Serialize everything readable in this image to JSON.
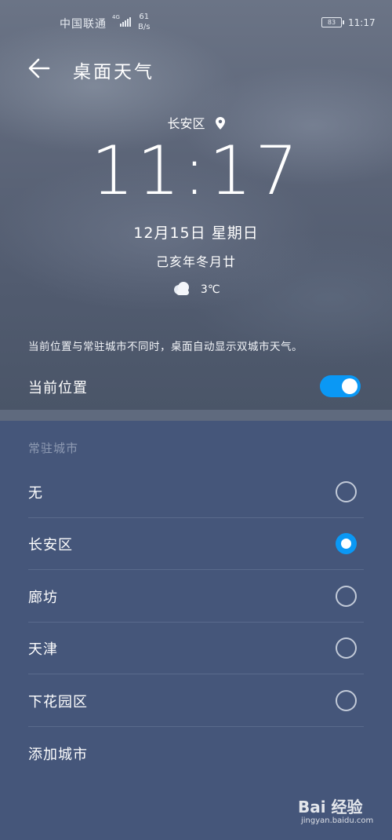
{
  "status_bar": {
    "carrier": "中国联通",
    "network": "4G",
    "speed_value": "61",
    "speed_unit": "B/s",
    "battery": "83",
    "time": "11:17"
  },
  "header": {
    "title": "桌面天气"
  },
  "weather_card": {
    "location": "长安区",
    "time": "11:17",
    "date": "12月15日 星期日",
    "lunar_date": "己亥年冬月廿",
    "temperature": "3℃"
  },
  "notice": "当前位置与常驻城市不同时，桌面自动显示双城市天气。",
  "current_location": {
    "label": "当前位置",
    "enabled": true
  },
  "resident_city": {
    "heading": "常驻城市",
    "options": [
      {
        "label": "无",
        "selected": false
      },
      {
        "label": "长安区",
        "selected": true
      },
      {
        "label": "廊坊",
        "selected": false
      },
      {
        "label": "天津",
        "selected": false
      },
      {
        "label": "下花园区",
        "selected": false
      }
    ],
    "add_label": "添加城市"
  },
  "watermark": {
    "brand": "Bai 经验",
    "url": "jingyan.baidu.com"
  },
  "colors": {
    "accent": "#0a98f5",
    "list_background": "#45567a"
  }
}
